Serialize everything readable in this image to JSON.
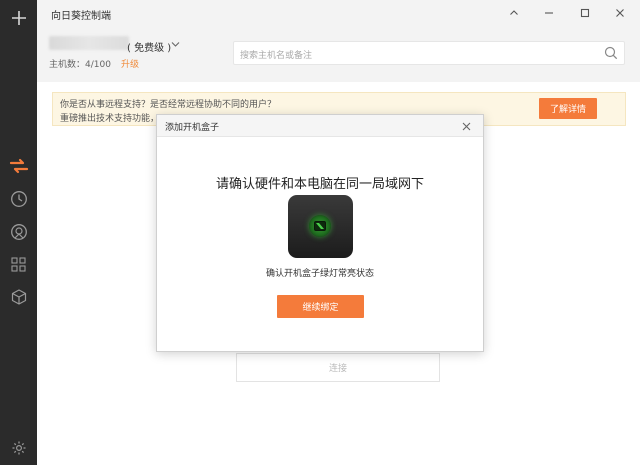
{
  "window": {
    "title": "向日葵控制端"
  },
  "header": {
    "plan": "( 免费级 )",
    "host_count": "主机数：4/100",
    "upgrade": "升级",
    "search_placeholder": "搜索主机名或备注"
  },
  "notice": {
    "line1": "你是否从事远程支持？是否经常远程协助不同的用户？",
    "line2": "重磅推出技术支持功能，",
    "more_button": "了解详情"
  },
  "background": {
    "connect_button": "连接"
  },
  "modal": {
    "title": "添加开机盒子",
    "heading": "请确认硬件和本电脑在同一局域网下",
    "status_text": "确认开机盒子绿灯常亮状态",
    "continue_button": "继续绑定"
  },
  "colors": {
    "accent": "#f47b3b",
    "rail": "#2b2b2b",
    "active_icon": "#f47b3b"
  },
  "icons": [
    "plus-icon",
    "remote-arrows-icon",
    "history-clock-icon",
    "remote-desktop-icon",
    "apps-grid-icon",
    "cube-icon",
    "settings-gear-icon"
  ]
}
